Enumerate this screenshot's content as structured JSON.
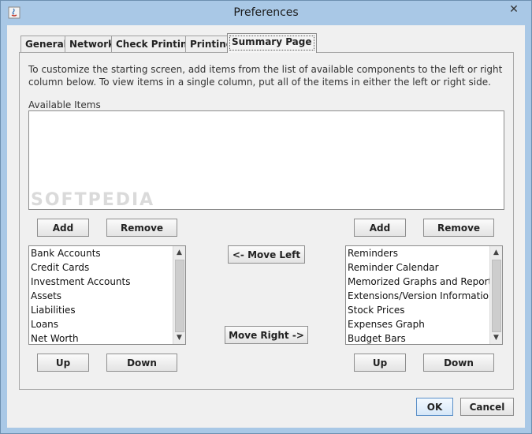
{
  "window": {
    "title": "Preferences",
    "icon": "java-app-icon",
    "close_icon": "close-icon"
  },
  "tabs": [
    {
      "label": "General",
      "active": false
    },
    {
      "label": "Network",
      "active": false
    },
    {
      "label": "Check Printing",
      "active": false
    },
    {
      "label": "Printing",
      "active": false
    },
    {
      "label": "Summary Page",
      "active": true
    }
  ],
  "summary": {
    "description": "To customize the starting screen, add items from the list of available components to the left or right column below.  To view items in a single column, put all of the items in either the left or right side.",
    "available_label": "Available Items",
    "left_add": "Add",
    "left_remove": "Remove",
    "right_add": "Add",
    "right_remove": "Remove",
    "left_items": [
      "Bank Accounts",
      "Credit Cards",
      "Investment Accounts",
      "Assets",
      "Liabilities",
      "Loans",
      "Net Worth"
    ],
    "right_items": [
      "Reminders",
      "Reminder Calendar",
      "Memorized Graphs and Reports",
      "Extensions/Version Information",
      "Stock Prices",
      "Expenses Graph",
      "Budget Bars"
    ],
    "move_left": "<- Move Left",
    "move_right": "Move Right ->",
    "left_up": "Up",
    "left_down": "Down",
    "right_up": "Up",
    "right_down": "Down"
  },
  "footer": {
    "ok": "OK",
    "cancel": "Cancel"
  },
  "watermark": "SOFTPEDIA"
}
